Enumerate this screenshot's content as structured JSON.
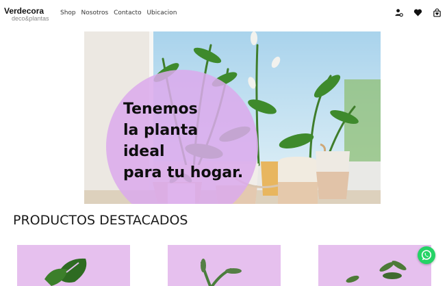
{
  "brand": {
    "name": "Verdecora",
    "tagline": "deco&plantas"
  },
  "nav": {
    "links": [
      "Shop",
      "Nosotros",
      "Contacto",
      "Ubicacion"
    ]
  },
  "header_icons": [
    "user-settings-icon",
    "heart-icon",
    "shopping-bag-icon"
  ],
  "hero": {
    "text": "Tenemos\nla planta\nideal\npara tu hogar."
  },
  "products": {
    "title": "PRODUCTOS DESTACADOS",
    "card_count": 3
  },
  "colors": {
    "accent": "#dbaaec",
    "card_bg": "#e6c0ee",
    "whatsapp": "#25d366"
  },
  "floating": {
    "icon": "whatsapp-icon"
  }
}
